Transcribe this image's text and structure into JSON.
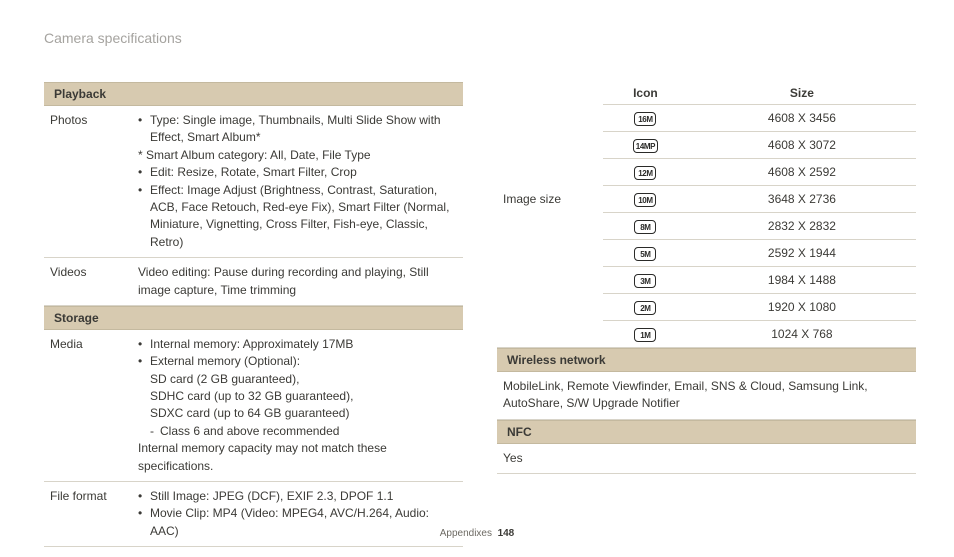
{
  "header": "Camera specifications",
  "left": {
    "playback_hdr": "Playback",
    "photos_lbl": "Photos",
    "photos_type": "Type: Single image, Thumbnails, Multi Slide Show with Effect, Smart Album*",
    "photos_smartalbum": "* Smart Album category: All, Date, File Type",
    "photos_edit": "Edit: Resize, Rotate, Smart Filter, Crop",
    "photos_effect": "Effect: Image Adjust (Brightness, Contrast, Saturation, ACB, Face Retouch, Red-eye Fix), Smart Filter (Normal, Miniature, Vignetting, Cross Filter, Fish-eye, Classic, Retro)",
    "videos_lbl": "Videos",
    "videos_val": "Video editing: Pause during recording and playing, Still image capture, Time trimming",
    "storage_hdr": "Storage",
    "media_lbl": "Media",
    "media_int": "Internal memory: Approximately 17MB",
    "media_ext": "External memory (Optional):",
    "media_sd": "SD card (2 GB guaranteed),",
    "media_sdhc": "SDHC card (up to 32 GB guaranteed),",
    "media_sdxc": "SDXC card (up to 64 GB guaranteed)",
    "media_class": "Class 6 and above recommended",
    "media_note": "Internal memory capacity may not match these specifications.",
    "ff_lbl": "File format",
    "ff_still": "Still Image: JPEG (DCF), EXIF 2.3, DPOF 1.1",
    "ff_movie": "Movie Clip: MP4 (Video: MPEG4, AVC/H.264, Audio: AAC)"
  },
  "right": {
    "imgsize_lbl": "Image size",
    "th_icon": "Icon",
    "th_size": "Size",
    "sizes": [
      {
        "icon": "16M",
        "size": "4608 X 3456"
      },
      {
        "icon": "14MP",
        "size": "4608 X 3072"
      },
      {
        "icon": "12M",
        "size": "4608 X 2592"
      },
      {
        "icon": "10M",
        "size": "3648 X 2736"
      },
      {
        "icon": "8M",
        "size": "2832 X 2832"
      },
      {
        "icon": "5M",
        "size": "2592 X 1944"
      },
      {
        "icon": "3M",
        "size": "1984 X 1488"
      },
      {
        "icon": "2M",
        "size": "1920 X 1080"
      },
      {
        "icon": "1M",
        "size": "1024 X 768"
      }
    ],
    "wireless_hdr": "Wireless network",
    "wireless_val": "MobileLink, Remote Viewfinder, Email, SNS & Cloud, Samsung Link, AutoShare, S/W Upgrade Notifier",
    "nfc_hdr": "NFC",
    "nfc_val": "Yes"
  },
  "footer_section": "Appendixes",
  "footer_page": "148"
}
